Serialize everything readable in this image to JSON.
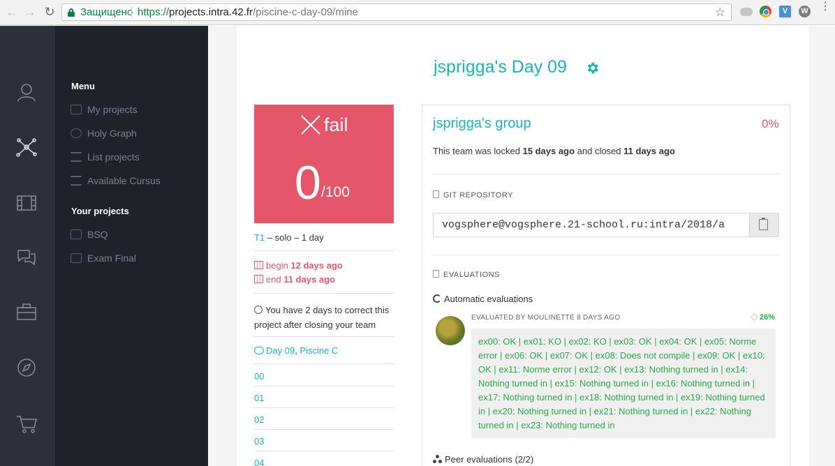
{
  "browser": {
    "secure_label": "Защищено",
    "url_scheme": "https://",
    "url_host": "projects.intra.42.fr",
    "url_path": "/piscine-c-day-09/mine"
  },
  "rail": {
    "icons": [
      "user-icon",
      "graph-icon",
      "film-icon",
      "chat-icon",
      "briefcase-icon",
      "compass-icon",
      "cart-icon"
    ]
  },
  "sidebar": {
    "menu_heading": "Menu",
    "menu_items": [
      "My projects",
      "Holy Graph",
      "List projects",
      "Available Cursus"
    ],
    "projects_heading": "Your projects",
    "project_items": [
      "BSQ",
      "Exam Final"
    ]
  },
  "page": {
    "title": "jsprigga's Day 09"
  },
  "score": {
    "status": "fail",
    "value": "0",
    "max": "/100"
  },
  "meta": {
    "tier": "T1",
    "tier_rest": " – solo – 1 day",
    "begin_label": "begin ",
    "begin_value": "12 days ago",
    "end_label": "end ",
    "end_value": "11 days ago",
    "correction_note": "You have 2 days to correct this project after closing your team",
    "project_link": "Day 09",
    "project_sep": ", ",
    "cursus_link": "Piscine C"
  },
  "exercises": [
    "00",
    "01",
    "02",
    "03",
    "04"
  ],
  "team": {
    "name": "jsprigga's group",
    "percent": "0%",
    "locked_prefix": "This team was locked ",
    "locked_when": "15 days ago",
    "locked_mid": " and closed ",
    "closed_when": "11 days ago",
    "git_label": "GIT REPOSITORY",
    "repo_url": "vogsphere@vogsphere.21-school.ru:intra/2018/a",
    "evaluations_label": "EVALUATIONS",
    "auto_eval_label": "Automatic evaluations",
    "evaluated_by": "EVALUATED BY MOULINETTE 8 DAYS AGO",
    "eval_percent": "26%",
    "trace": "ex00: OK | ex01: KO | ex02: KO | ex03: OK | ex04: OK | ex05: Norme error | ex06: OK | ex07: OK | ex08: Does not compile | ex09: OK | ex10: OK | ex11: Norme error | ex12: OK | ex13: Nothing turned in | ex14: Nothing turned in | ex15: Nothing turned in | ex16: Nothing turned in | ex17: Nothing turned in | ex18: Nothing turned in | ex19: Nothing turned in | ex20: Nothing turned in | ex21: Nothing turned in | ex22: Nothing turned in | ex23: Nothing turned in",
    "peer_eval_label": "Peer evaluations (2/2)"
  },
  "colors": {
    "accent": "#1fb2b2",
    "fail": "#e5566b",
    "ok_green": "#2ba84a",
    "sidebar_bg": "#1f2228",
    "rail_bg": "#2d3038"
  }
}
